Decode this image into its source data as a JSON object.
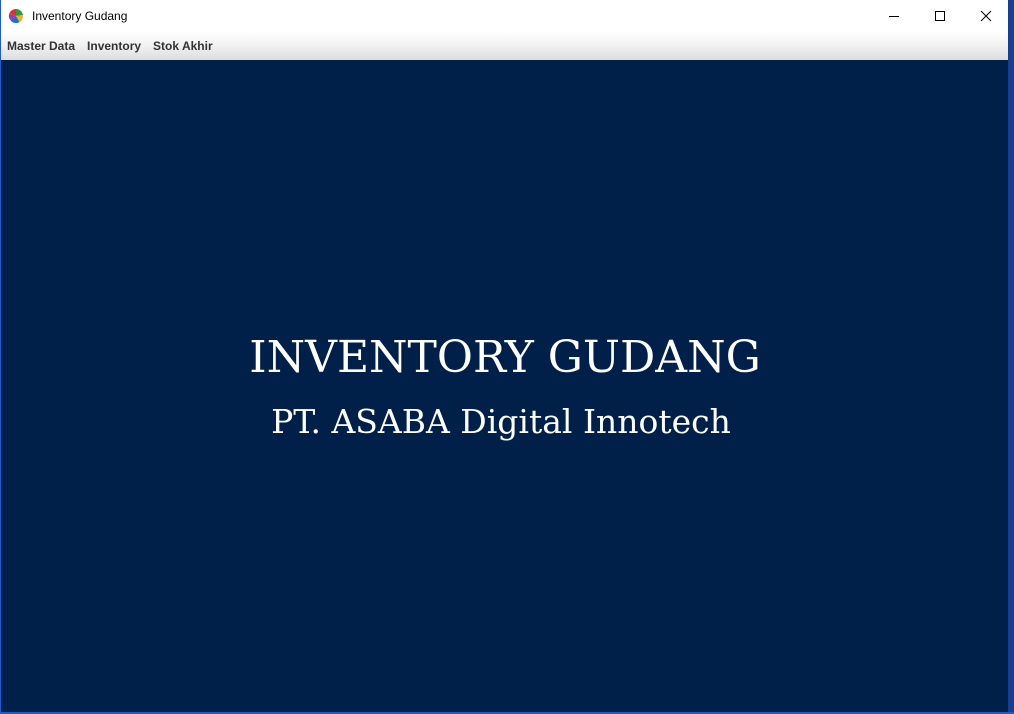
{
  "window": {
    "title": "Inventory Gudang",
    "icon": "pie-chart-app-icon",
    "controls": {
      "minimize_icon": "minimize-icon",
      "maximize_icon": "maximize-icon",
      "close_icon": "close-icon"
    }
  },
  "menubar": {
    "items": [
      {
        "label": "Master Data"
      },
      {
        "label": "Inventory"
      },
      {
        "label": "Stok Akhir"
      }
    ]
  },
  "main": {
    "headline": "INVENTORY GUDANG",
    "company": "PT. ASABA Digital Innotech"
  },
  "colors": {
    "background": "#00204a",
    "text": "#ffffff",
    "window_border": "#1c5cc8"
  }
}
